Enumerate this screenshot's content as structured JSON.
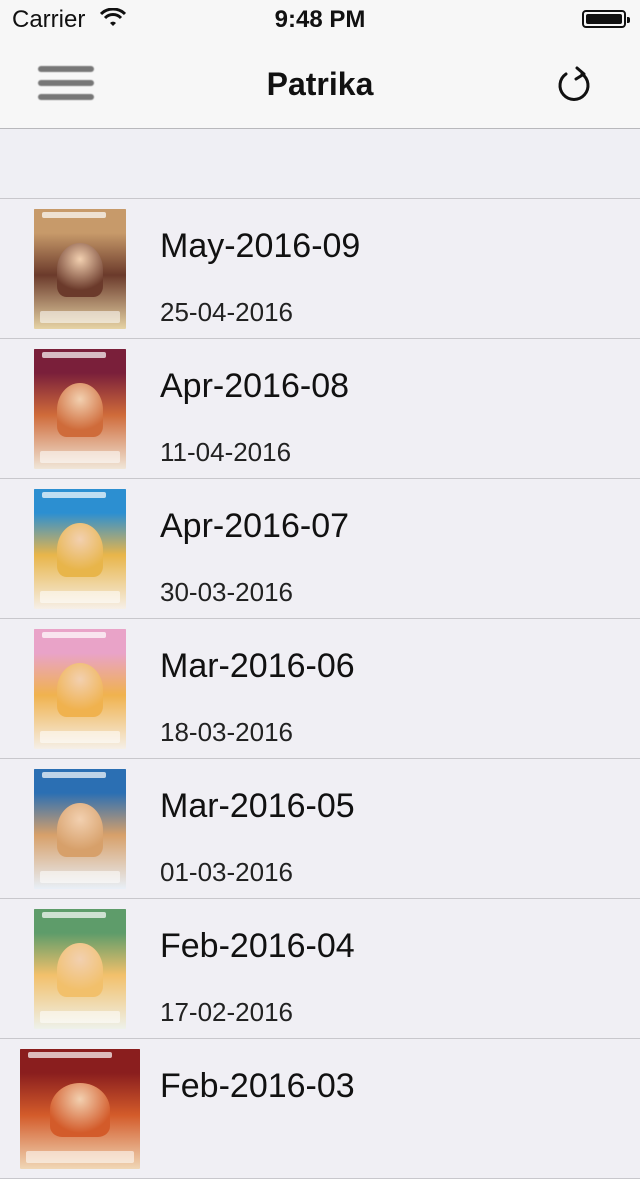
{
  "status": {
    "carrier": "Carrier",
    "time": "9:48 PM"
  },
  "nav": {
    "title": "Patrika"
  },
  "icons": {
    "menu": "hamburger-icon",
    "refresh": "refresh-icon",
    "wifi": "wifi-icon",
    "battery": "battery-icon"
  },
  "items": [
    {
      "name": "May-2016-09",
      "date": "25-04-2016",
      "colors": [
        "#c79a6a",
        "#6b3a2b",
        "#e6d3a5"
      ]
    },
    {
      "name": "Apr-2016-08",
      "date": "11-04-2016",
      "colors": [
        "#7a1f3a",
        "#cf6b3a",
        "#f0e6d8"
      ]
    },
    {
      "name": "Apr-2016-07",
      "date": "30-03-2016",
      "colors": [
        "#2c8fd1",
        "#e8b54a",
        "#f6efe7"
      ]
    },
    {
      "name": "Mar-2016-06",
      "date": "18-03-2016",
      "colors": [
        "#e9a3c8",
        "#f0b24e",
        "#f5efe7"
      ]
    },
    {
      "name": "Mar-2016-05",
      "date": "01-03-2016",
      "colors": [
        "#2b6fb3",
        "#d7a06a",
        "#e8eff7"
      ]
    },
    {
      "name": "Feb-2016-04",
      "date": "17-02-2016",
      "colors": [
        "#5e9c6a",
        "#f2c06b",
        "#eef1ea"
      ]
    },
    {
      "name": "Feb-2016-03",
      "date": "",
      "colors": [
        "#8a1e1e",
        "#d35b2a",
        "#f0d7b6"
      ]
    }
  ]
}
